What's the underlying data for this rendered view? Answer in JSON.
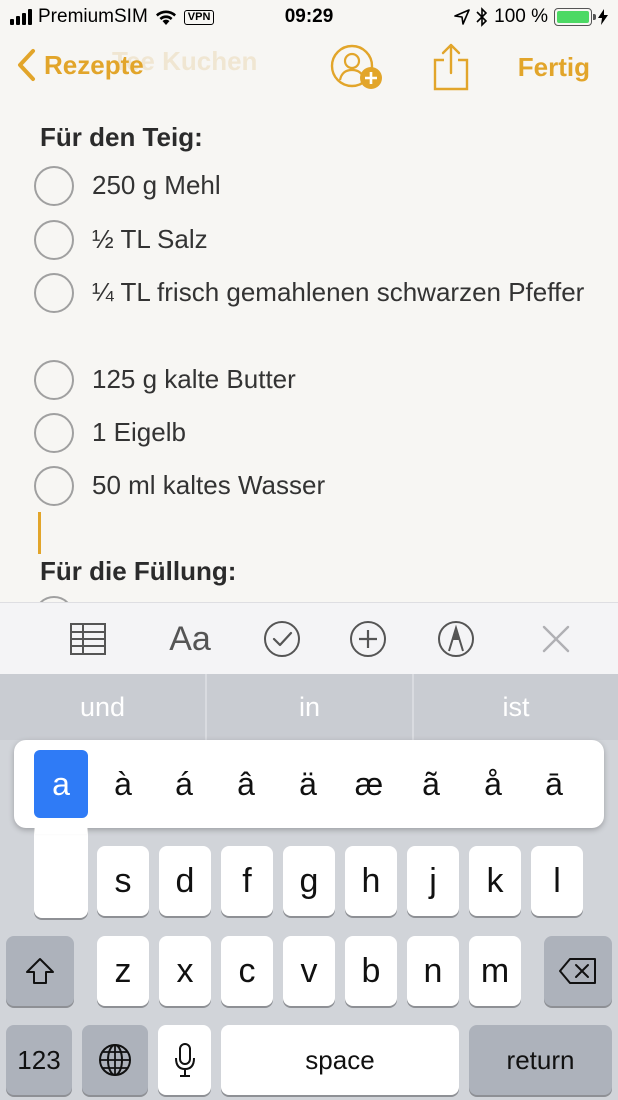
{
  "status_bar": {
    "carrier": "PremiumSIM",
    "vpn": "VPN",
    "time": "09:29",
    "battery_percent": "100 %",
    "battery_level": 1.0,
    "battery_color": "#4cd964",
    "icons": [
      "signal-bars",
      "wifi-icon",
      "location-icon",
      "bluetooth-icon",
      "charging-bolt-icon"
    ]
  },
  "nav": {
    "back_label": "Rezepte",
    "done_label": "Fertig",
    "accent_color": "#e2a52a",
    "ghost_title": "Tee Kuchen"
  },
  "note": {
    "heading_1": "Für den Teig:",
    "items": [
      "250 g Mehl",
      "½ TL Salz",
      "¼ TL frisch gemahlenen schwarzen Pfeffer",
      "125 g kalte Butter",
      "1 Eigelb",
      "50 ml kaltes Wasser"
    ],
    "heading_2": "Für die Füllung:"
  },
  "toolbar": {
    "icons": [
      "table-icon",
      "text-format-icon",
      "checklist-icon",
      "add-icon",
      "markup-pen-icon",
      "close-icon"
    ],
    "text_format_label": "Aa"
  },
  "keyboard": {
    "predictions": [
      "und",
      "in",
      "ist"
    ],
    "accent_popup": [
      "a",
      "à",
      "á",
      "â",
      "ä",
      "æ",
      "ã",
      "å",
      "ā"
    ],
    "accent_selected": "a",
    "row2": [
      "s",
      "d",
      "f",
      "g",
      "h",
      "j",
      "k",
      "l"
    ],
    "row3": [
      "z",
      "x",
      "c",
      "v",
      "b",
      "n",
      "m"
    ],
    "numbers_label": "123",
    "space_label": "space",
    "return_label": "return"
  }
}
